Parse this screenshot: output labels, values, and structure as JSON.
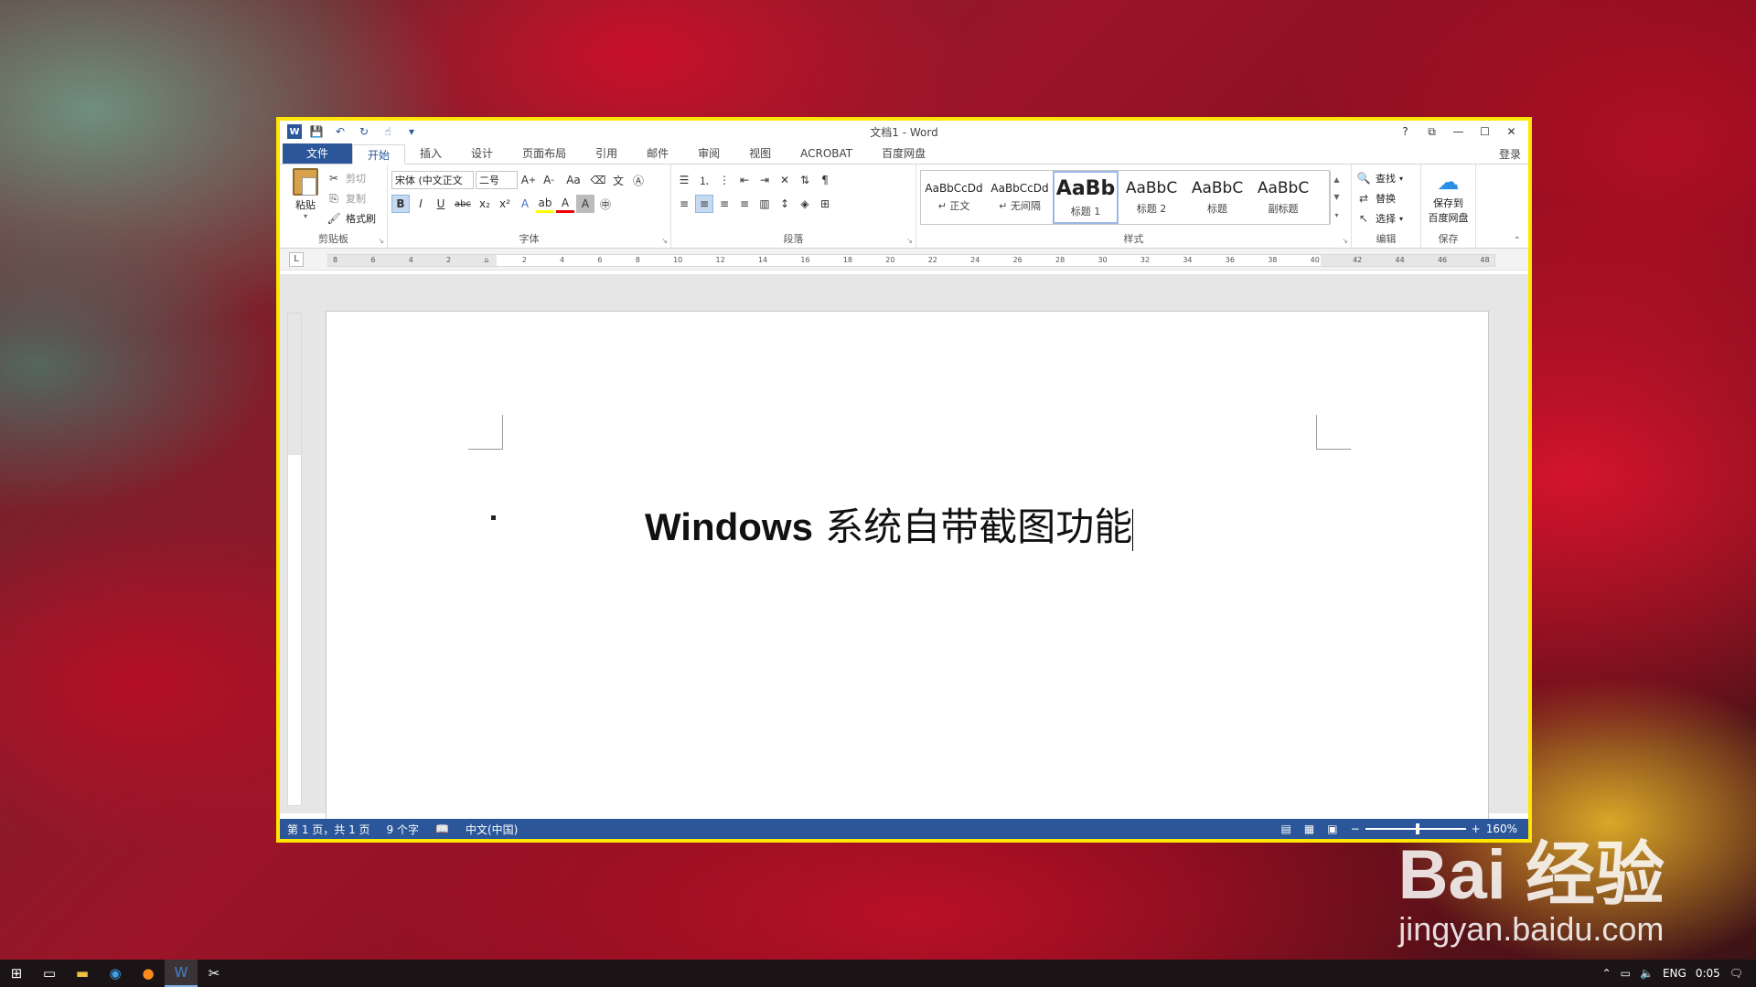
{
  "window": {
    "title": "文档1 - Word",
    "controls": [
      "?",
      "⧉",
      "—",
      "☐",
      "✕"
    ]
  },
  "qat": {
    "items": [
      "save-icon",
      "undo-icon",
      "redo-icon",
      "touch-mode-icon",
      "customize-icon"
    ]
  },
  "tabs": {
    "file": "文件",
    "items": [
      "开始",
      "插入",
      "设计",
      "页面布局",
      "引用",
      "邮件",
      "审阅",
      "视图",
      "ACROBAT",
      "百度网盘"
    ],
    "active": "开始",
    "login": "登录"
  },
  "ribbon": {
    "clipboard": {
      "label": "剪贴板",
      "paste": "粘贴",
      "cut": "剪切",
      "copy": "复制",
      "format_painter": "格式刷"
    },
    "font": {
      "label": "字体",
      "font_name": "宋体 (中文正文",
      "font_size": "二号",
      "change_case": "Aa",
      "bold": "B",
      "italic": "I",
      "underline": "U",
      "strike": "abc",
      "subscript": "x₂",
      "superscript": "x²"
    },
    "paragraph": {
      "label": "段落"
    },
    "styles": {
      "label": "样式",
      "items": [
        {
          "preview": "AaBbCcDd",
          "name": "↵ 正文"
        },
        {
          "preview": "AaBbCcDd",
          "name": "↵ 无间隔"
        },
        {
          "preview": "AaBb",
          "name": "标题 1"
        },
        {
          "preview": "AaBbC",
          "name": "标题 2"
        },
        {
          "preview": "AaBbC",
          "name": "标题"
        },
        {
          "preview": "AaBbC",
          "name": "副标题"
        }
      ]
    },
    "editing": {
      "label": "编辑",
      "find": "查找",
      "replace": "替换",
      "select": "选择"
    },
    "save": {
      "label": "保存",
      "save_to": "保存到",
      "baidu": "百度网盘"
    }
  },
  "ruler": {
    "ticks": [
      "8",
      "6",
      "4",
      "2",
      "",
      "2",
      "4",
      "6",
      "8",
      "10",
      "12",
      "14",
      "16",
      "18",
      "20",
      "22",
      "24",
      "26",
      "28",
      "30",
      "32",
      "34",
      "36",
      "38",
      "40",
      "42",
      "44",
      "46",
      "48"
    ],
    "tab_selector": "L"
  },
  "document": {
    "text_en": "Windows",
    "text_zh": " 系统自带截图功能"
  },
  "status": {
    "page": "第 1 页，共 1 页",
    "words": "9 个字",
    "language": "中文(中国)",
    "zoom": "160%"
  },
  "taskbar": {
    "tray_lang": "ENG",
    "time": "0:05"
  },
  "watermark": {
    "brand": "Bai 经验",
    "url": "jingyan.baidu.com"
  },
  "colors": {
    "accent": "#2b579a",
    "highlight_border": "#ffe600"
  }
}
